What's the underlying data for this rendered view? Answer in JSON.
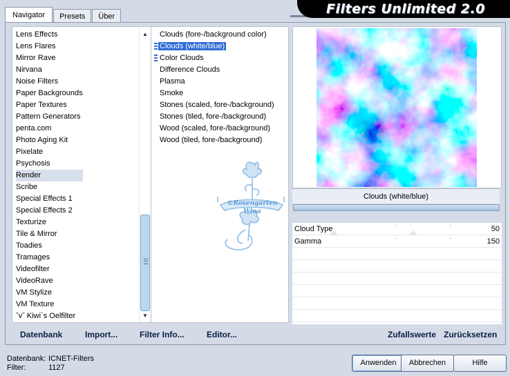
{
  "app": {
    "title": "Filters Unlimited 2.0"
  },
  "tabs": [
    {
      "label": "Navigator",
      "active": true
    },
    {
      "label": "Presets",
      "active": false
    },
    {
      "label": "Über",
      "active": false
    }
  ],
  "categories": [
    "Lens Effects",
    "Lens Flares",
    "Mirror Rave",
    "Nirvana",
    "Noise Filters",
    "Paper Backgrounds",
    "Paper Textures",
    "Pattern Generators",
    "penta.com",
    "Photo Aging Kit",
    "Pixelate",
    "Psychosis",
    "Render",
    "Scribe",
    "Special Effects 1",
    "Special Effects 2",
    "Texturize",
    "Tile & Mirror",
    "Toadies",
    "Tramages",
    "Videofilter",
    "VideoRave",
    "VM Stylize",
    "VM Texture",
    "ˇvˇ Kiwi`s Oelfilter"
  ],
  "selected_category": "Render",
  "filters": [
    "Clouds (fore-/background color)",
    "Clouds (white/blue)",
    "Color Clouds",
    "Difference Clouds",
    "Plasma",
    "Smoke",
    "Stones (scaled, fore-/background)",
    "Stones (tiled, fore-/background)",
    "Wood (scaled, fore-/background)",
    "Wood (tiled, fore-/background)"
  ],
  "selected_filter": "Clouds (white/blue)",
  "watermark": {
    "line1": "©Rosengarten",
    "line2": "Wina"
  },
  "preview": {
    "caption": "Clouds (white/blue)"
  },
  "params": [
    {
      "label": "Cloud Type",
      "value": "50"
    },
    {
      "label": "Gamma",
      "value": "150"
    }
  ],
  "toolbar": {
    "datenbank": "Datenbank",
    "import": "Import...",
    "filter_info": "Filter Info...",
    "editor": "Editor...",
    "zufallswerte": "Zufallswerte",
    "zuruecksetzen": "Zurücksetzen"
  },
  "status": {
    "db_label": "Datenbank:",
    "db_value": "ICNET-Filters",
    "filter_label": "Filter:",
    "filter_value": "1127"
  },
  "buttons": {
    "apply": "Anwenden",
    "cancel": "Abbrechen",
    "help": "Hilfe"
  }
}
